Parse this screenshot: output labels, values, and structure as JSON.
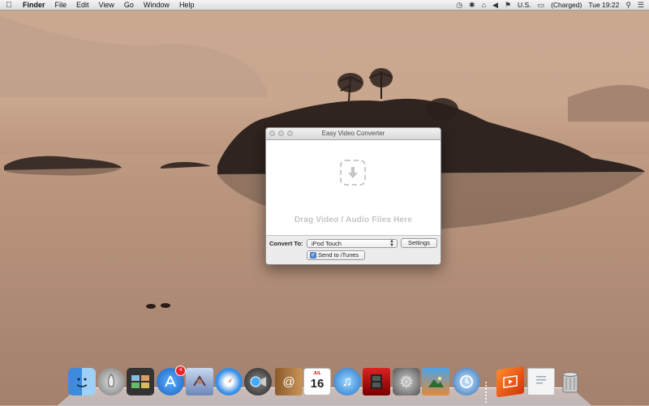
{
  "menubar": {
    "app_name": "Finder",
    "menus": [
      "File",
      "Edit",
      "View",
      "Go",
      "Window",
      "Help"
    ],
    "input_source": "U.S.",
    "battery_status": "(Charged)",
    "clock": "Tue 19:22"
  },
  "window": {
    "title": "Easy Video Converter",
    "drop_text": "Drag Video / Audio Files Here",
    "convert_label": "Convert To:",
    "format_selected": "iPod Touch",
    "settings_label": "Settings",
    "itunes_label": "Send to iTunes",
    "itunes_checked": true
  },
  "dock": {
    "calendar_month": "JUL",
    "calendar_day": "16",
    "appstore_badge": "4",
    "icons": [
      "finder-icon",
      "launchpad-icon",
      "mission-control-icon",
      "app-store-icon",
      "mail-icon",
      "safari-icon",
      "facetime-icon",
      "contacts-icon",
      "calendar-icon",
      "itunes-icon",
      "photo-booth-icon",
      "system-preferences-icon",
      "iphoto-icon",
      "time-machine-icon",
      "video-converter-icon",
      "document-icon",
      "trash-icon"
    ]
  },
  "colors": {
    "menubar_bg": "#e6e6e6",
    "drop_text": "#c4c4c4",
    "checkbox_blue": "#5a8fd8",
    "badge_red": "#e22222"
  }
}
